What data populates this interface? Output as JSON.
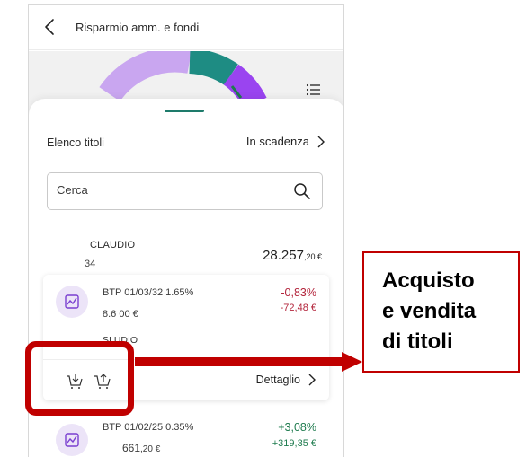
{
  "header": {
    "title": "Risparmio amm. e fondi"
  },
  "list_header": {
    "label": "Elenco titoli",
    "sort_label": "In scadenza"
  },
  "search": {
    "placeholder": "Cerca"
  },
  "account": {
    "name": "CLAUDIO",
    "number": "34",
    "balance_int": "28.257",
    "balance_dec": ",20 €"
  },
  "securities": [
    {
      "name": "BTP 01/03/32 1.65%",
      "value": "8.6     00 €",
      "pct": "-0,83%",
      "amount": "-72,48 €",
      "owner": "SI            UDIO",
      "detail_label": "Dettaglio"
    },
    {
      "name": "BTP 01/02/25 0.35%",
      "value_int": "661",
      "value_dec": ",20 €",
      "pct": "+3,08%",
      "amount": "+319,35 €"
    }
  ],
  "callout": {
    "line1": "Acquisto",
    "line2": "e vendita",
    "line3": "di titoli"
  },
  "colors": {
    "accent_green": "#1e7b6b",
    "donut_purple_light": "#c9a6f0",
    "donut_purple": "#9a44f0",
    "negative": "#b3243b",
    "positive": "#1e7b4e",
    "annotation_red": "#c00000"
  },
  "icons": [
    "chevron-left-icon",
    "list-icon",
    "search-icon",
    "chevron-right-icon",
    "chart-icon",
    "cart-buy-icon",
    "cart-sell-icon"
  ]
}
